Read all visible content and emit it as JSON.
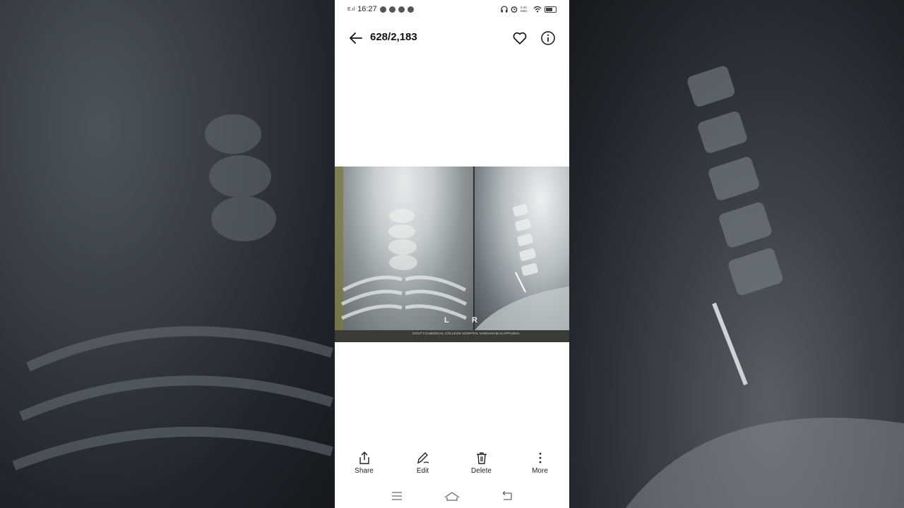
{
  "status_bar": {
    "time": "16:27",
    "network_speed": "0.40 KB/s"
  },
  "header": {
    "counter": "628/2,183"
  },
  "photo": {
    "left_marker": "L",
    "right_marker": "R",
    "caption": "GOVT.T.D.MEDICAL COLLEGE HOSPITAL VANDANAM,ALAPPUZHA"
  },
  "toolbar": {
    "share_label": "Share",
    "edit_label": "Edit",
    "delete_label": "Delete",
    "more_label": "More"
  },
  "icons": {
    "back": "arrow-left-icon",
    "favorite": "heart-icon",
    "info": "info-icon",
    "share": "share-icon",
    "edit": "pen-icon",
    "delete": "trash-icon",
    "more": "more-vertical-icon",
    "menu": "menu-icon",
    "home": "home-icon",
    "back_nav": "back-nav-icon"
  }
}
